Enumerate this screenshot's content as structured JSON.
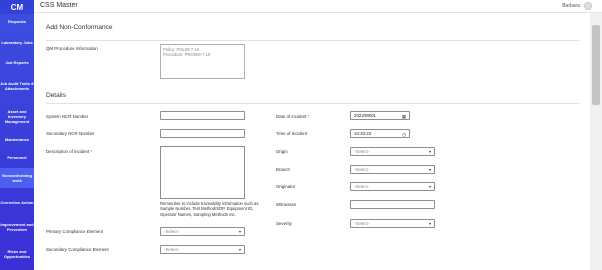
{
  "app": {
    "logo": "CM",
    "title": "CSS Master",
    "user": "Barbara"
  },
  "sidebar": {
    "items": [
      {
        "label": "Requests"
      },
      {
        "label": "Laboratory Jobs"
      },
      {
        "label": "Job Reports"
      },
      {
        "label": "Job Audit Trails & Attachments"
      },
      {
        "label": "Asset and Inventory Management"
      },
      {
        "label": "Maintenance"
      },
      {
        "label": "Personnel"
      },
      {
        "label": "Nonconforming work"
      },
      {
        "label": "Corrective Action"
      },
      {
        "label": "Improvement and Preventive"
      },
      {
        "label": "Risks and Opportunities"
      }
    ]
  },
  "page": {
    "heading": "Add Non-Conformance"
  },
  "qm": {
    "label": "QM Procedure Information",
    "line1": "Policy: POL08-7.10",
    "line2": "Procedure: PRO008-7.10"
  },
  "details": {
    "title": "Details",
    "system_ncr_label": "System NCR Number",
    "system_ncr_value": "",
    "secondary_ncr_label": "Secondary NCR Number",
    "secondary_ncr_value": "",
    "description_label": "Description of incident ",
    "description_helper": "Remember to include traceability information such as Sample Number, Test Method/SOP, Equipment ID, Operator Names, Sampling Methods etc.",
    "primary_compliance_label": "Primary Compliance Element",
    "primary_compliance_value": "-Select-",
    "secondary_compliance_label": "Secondary Compliance Element",
    "secondary_compliance_value": "-Select-",
    "date_label": "Date of incident ",
    "date_value": "2022/09/01",
    "time_label": "Time of Incident",
    "time_value": "10:33:23",
    "origin_label": "Origin",
    "origin_value": "-Select-",
    "branch_label": "Branch",
    "branch_value": "-Select-",
    "originator_label": "Originator",
    "originator_value": "-Select-",
    "witnesses_label": "Witnesses",
    "witnesses_value": "",
    "severity_label": "Severity",
    "severity_value": "-Select-",
    "required_mark": "*"
  },
  "icons": {
    "calendar": "calendar-icon",
    "clock": "clock-icon"
  }
}
